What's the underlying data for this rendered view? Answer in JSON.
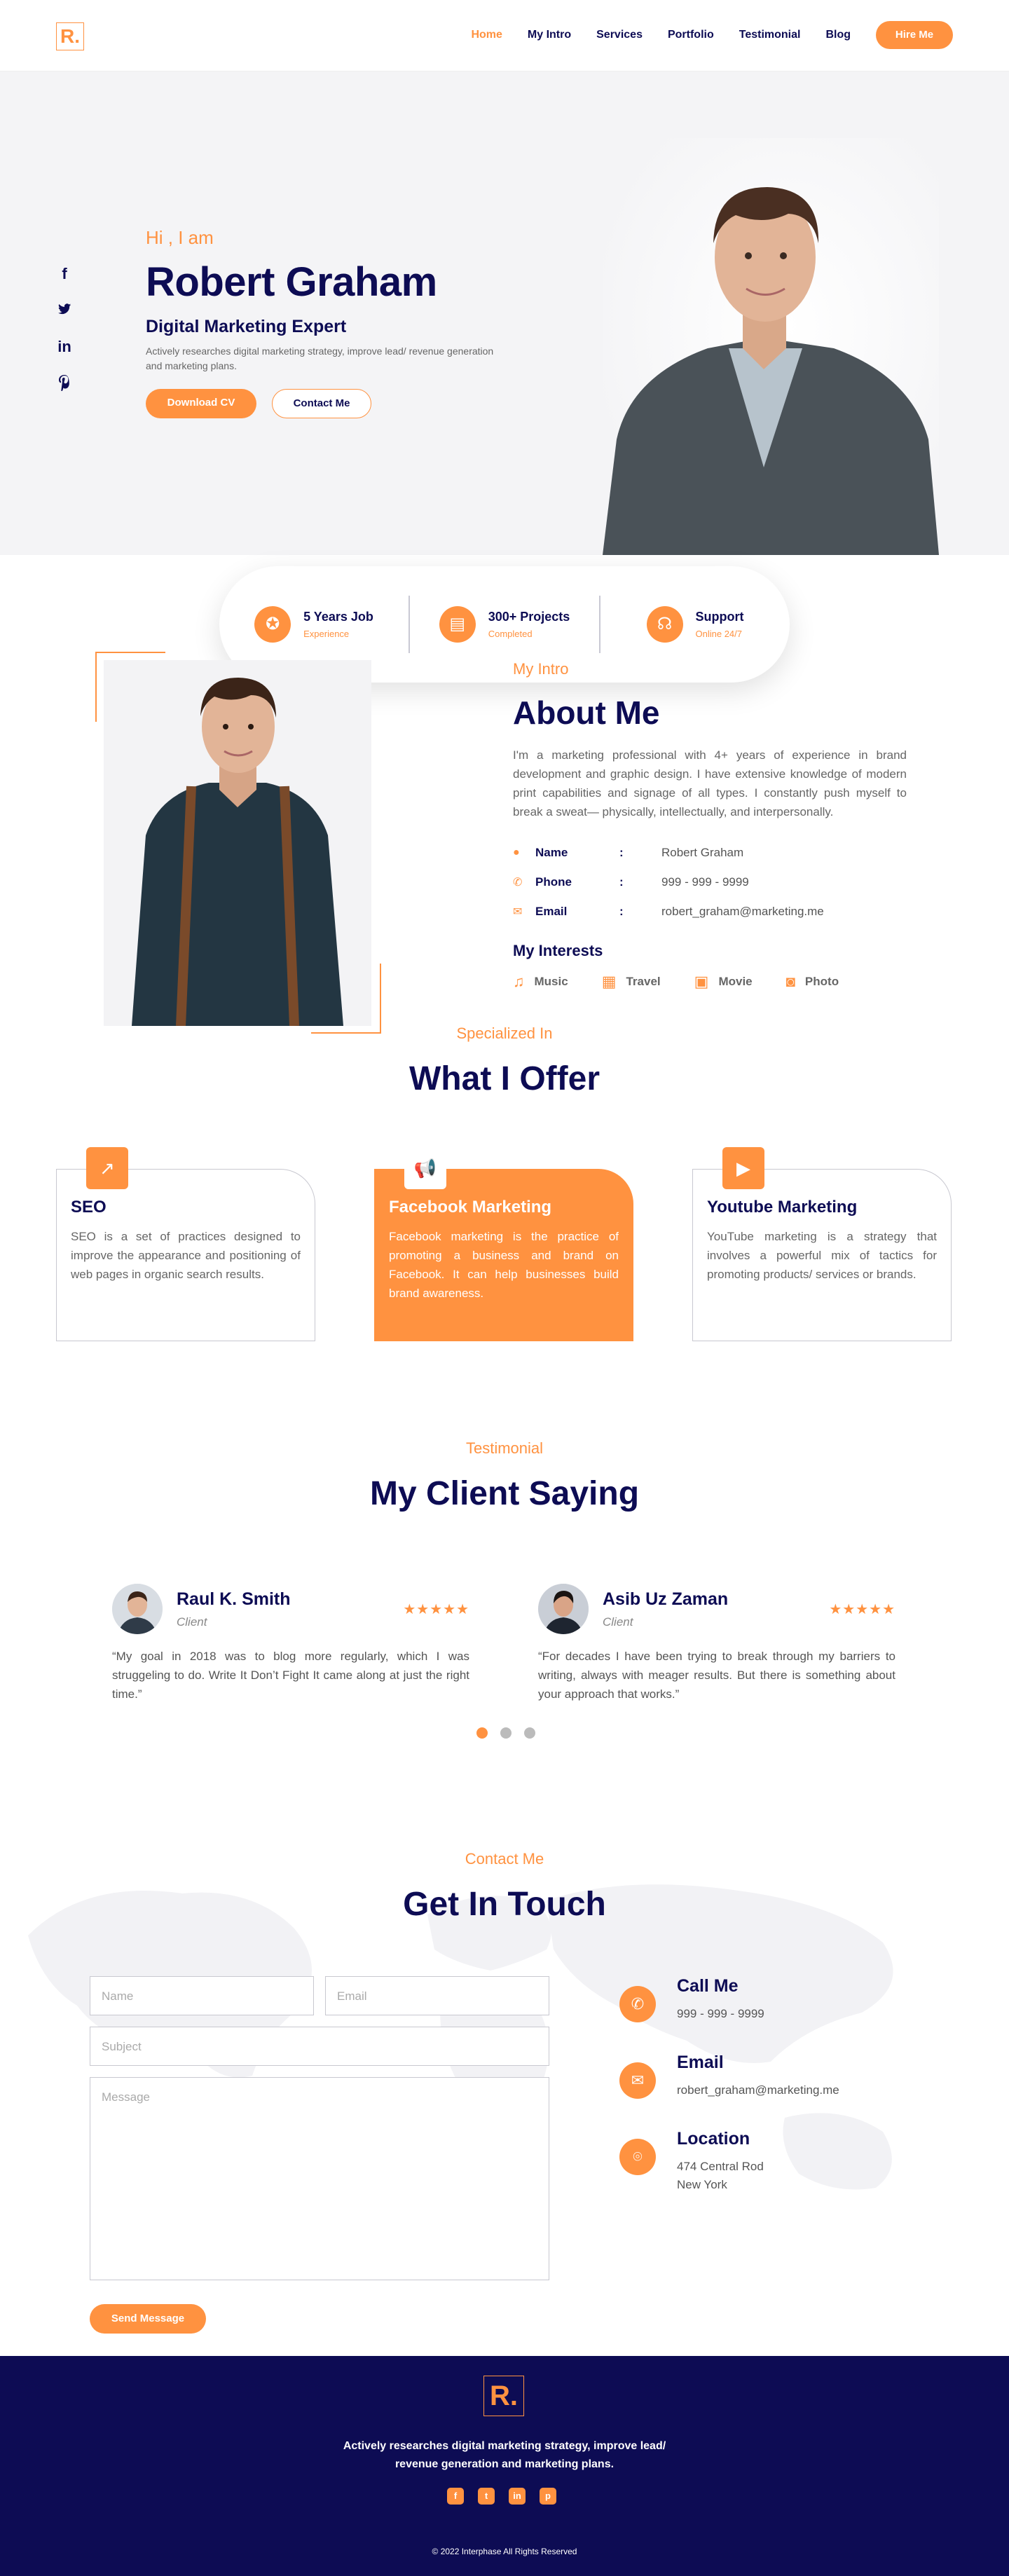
{
  "header": {
    "logo": "R.",
    "nav": [
      "Home",
      "My Intro",
      "Services",
      "Portfolio",
      "Testimonial",
      "Blog"
    ],
    "hire": "Hire Me"
  },
  "hero": {
    "greeting": "Hi , I am",
    "name": "Robert Graham",
    "role": "Digital Marketing Expert",
    "desc": "Actively researches digital marketing strategy, improve lead/ revenue generation and marketing plans.",
    "btn_cv": "Download CV",
    "btn_contact": "Contact Me",
    "social_icons": [
      "facebook-icon",
      "twitter-icon",
      "linkedin-icon",
      "pinterest-icon"
    ],
    "stats": [
      {
        "title": "5 Years Job",
        "sub": "Experience"
      },
      {
        "title": "300+ Projects",
        "sub": "Completed"
      },
      {
        "title": "Support",
        "sub": "Online 24/7"
      }
    ]
  },
  "about": {
    "eyebrow": "My Intro",
    "title": "About Me",
    "desc": "I'm a marketing professional with 4+ years of experience in brand development and graphic design. I have extensive knowledge of modern print capabilities and signage of all types. I constantly push myself to break a sweat— physically, intellectually, and interpersonally.",
    "info": [
      {
        "label": "Name",
        "value": "Robert Graham"
      },
      {
        "label": "Phone",
        "value": "999 - 999 - 9999"
      },
      {
        "label": "Email",
        "value": "robert_graham@marketing.me"
      }
    ],
    "interests_title": "My Interests",
    "interests": [
      "Music",
      "Travel",
      "Movie",
      "Photo"
    ]
  },
  "offer": {
    "eyebrow": "Specialized In",
    "title": "What I Offer",
    "cards": [
      {
        "title": "SEO",
        "desc": "SEO is a set of practices designed to improve the appearance and positioning of web pages in organic search results."
      },
      {
        "title": "Facebook Marketing",
        "desc": "Facebook marketing is the practice of promoting a business and brand on Facebook. It can help businesses build brand awareness."
      },
      {
        "title": "Youtube Marketing",
        "desc": "YouTube marketing is a strategy that involves a powerful mix of tactics for promoting products/ services or brands."
      }
    ]
  },
  "testimonial": {
    "eyebrow": "Testimonial",
    "title": "My Client Saying",
    "items": [
      {
        "name": "Raul K. Smith",
        "role": "Client",
        "quote": "“My goal in 2018 was to blog more regularly, which I was struggeling to do. Write It Don’t Fight It came along at just the right time.”"
      },
      {
        "name": "Asib Uz Zaman",
        "role": "Client",
        "quote": "“For decades I have been trying to break through my barriers to writing, always with meager results. But there is something about your approach that works.”"
      }
    ],
    "rating": 5
  },
  "contact": {
    "eyebrow": "Contact Me",
    "title": "Get In Touch",
    "placeholders": {
      "name": "Name",
      "email": "Email",
      "subject": "Subject",
      "message": "Message"
    },
    "send": "Send Message",
    "items": [
      {
        "title": "Call Me",
        "text": "999 - 999 - 9999"
      },
      {
        "title": "Email",
        "text": "robert_graham@marketing.me"
      },
      {
        "title": "Location",
        "line1": "474 Central Rod",
        "line2": "New York"
      }
    ]
  },
  "footer": {
    "logo": "R.",
    "text": "Actively researches digital marketing strategy, improve lead/ revenue generation and marketing plans.",
    "copyright": "© 2022 Interphase All Rights Reserved"
  }
}
